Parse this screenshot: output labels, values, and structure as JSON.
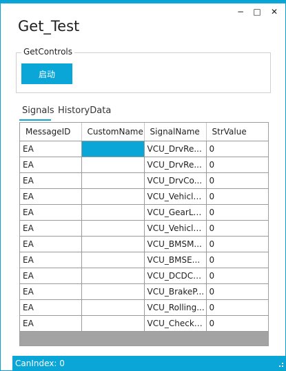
{
  "window": {
    "title": "Get_Test",
    "controls": {
      "minimize": "−",
      "maximize": "□",
      "close": "✕"
    }
  },
  "group": {
    "label": "GetControls",
    "start_button": "启动"
  },
  "tabs": [
    {
      "label": "Signals",
      "selected": true
    },
    {
      "label": "HistoryData",
      "selected": false
    }
  ],
  "grid": {
    "columns": [
      "MessageID",
      "CustomName",
      "SignalName",
      "StrValue"
    ],
    "rows": [
      {
        "message_id": "EA",
        "custom_name": "",
        "signal_name": "VCU_DrvRe...",
        "str_value": "0"
      },
      {
        "message_id": "EA",
        "custom_name": "",
        "signal_name": "VCU_DrvRe...",
        "str_value": "0"
      },
      {
        "message_id": "EA",
        "custom_name": "",
        "signal_name": "VCU_DrvCo...",
        "str_value": "0"
      },
      {
        "message_id": "EA",
        "custom_name": "",
        "signal_name": "VCU_Vehicle...",
        "str_value": "0"
      },
      {
        "message_id": "EA",
        "custom_name": "",
        "signal_name": "VCU_GearLe...",
        "str_value": "0"
      },
      {
        "message_id": "EA",
        "custom_name": "",
        "signal_name": "VCU_Vehicle...",
        "str_value": "0"
      },
      {
        "message_id": "EA",
        "custom_name": "",
        "signal_name": "VCU_BMSM...",
        "str_value": "0"
      },
      {
        "message_id": "EA",
        "custom_name": "",
        "signal_name": "VCU_BMSE...",
        "str_value": "0"
      },
      {
        "message_id": "EA",
        "custom_name": "",
        "signal_name": "VCU_DCDCE...",
        "str_value": "0"
      },
      {
        "message_id": "EA",
        "custom_name": "",
        "signal_name": "VCU_BrakeP...",
        "str_value": "0"
      },
      {
        "message_id": "EA",
        "custom_name": "",
        "signal_name": "VCU_Rolling...",
        "str_value": "0"
      },
      {
        "message_id": "EA",
        "custom_name": "",
        "signal_name": "VCU_CheckS...",
        "str_value": "0"
      }
    ]
  },
  "status": {
    "text": "CanIndex: 0"
  },
  "colors": {
    "accent": "#0aa6d8",
    "grid_empty": "#a3a3a3",
    "border": "#9a9a9a"
  }
}
